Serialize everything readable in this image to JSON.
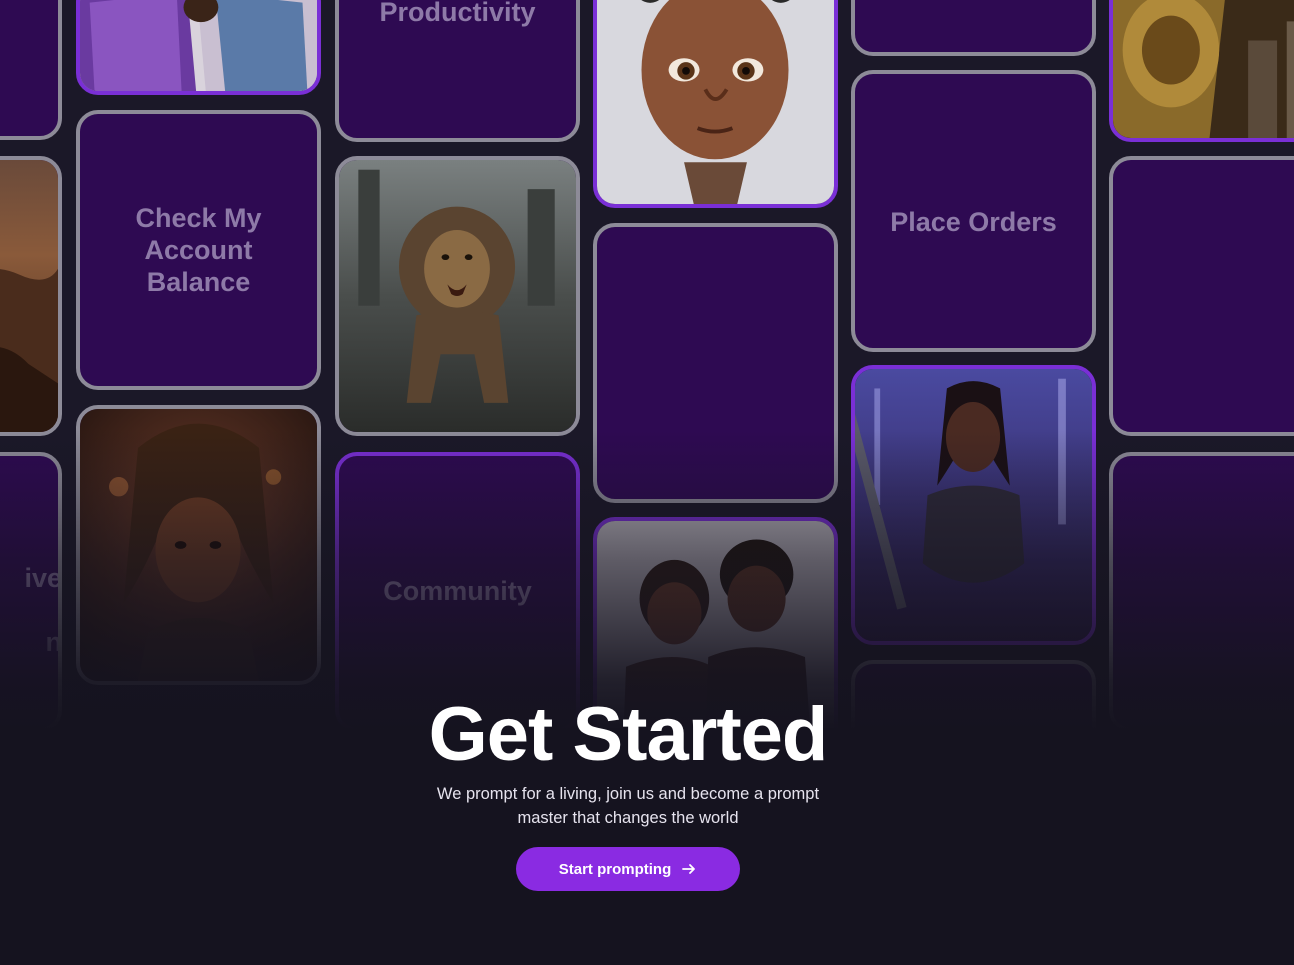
{
  "tiles": {
    "productivity": "Productivity",
    "check_balance": "Check My Account Balance",
    "place_orders": "Place Orders",
    "community": "Community",
    "partial_left_1": "ive",
    "partial_left_2": "n"
  },
  "hero": {
    "title": "Get Started",
    "subtitle": "We prompt for a living, join us and become a prompt master that changes the world",
    "cta_label": "Start prompting",
    "cta_icon": "arrow-right-icon"
  },
  "colors": {
    "background": "#15131f",
    "tile": "#2e0a52",
    "accent": "#8a2be2"
  }
}
